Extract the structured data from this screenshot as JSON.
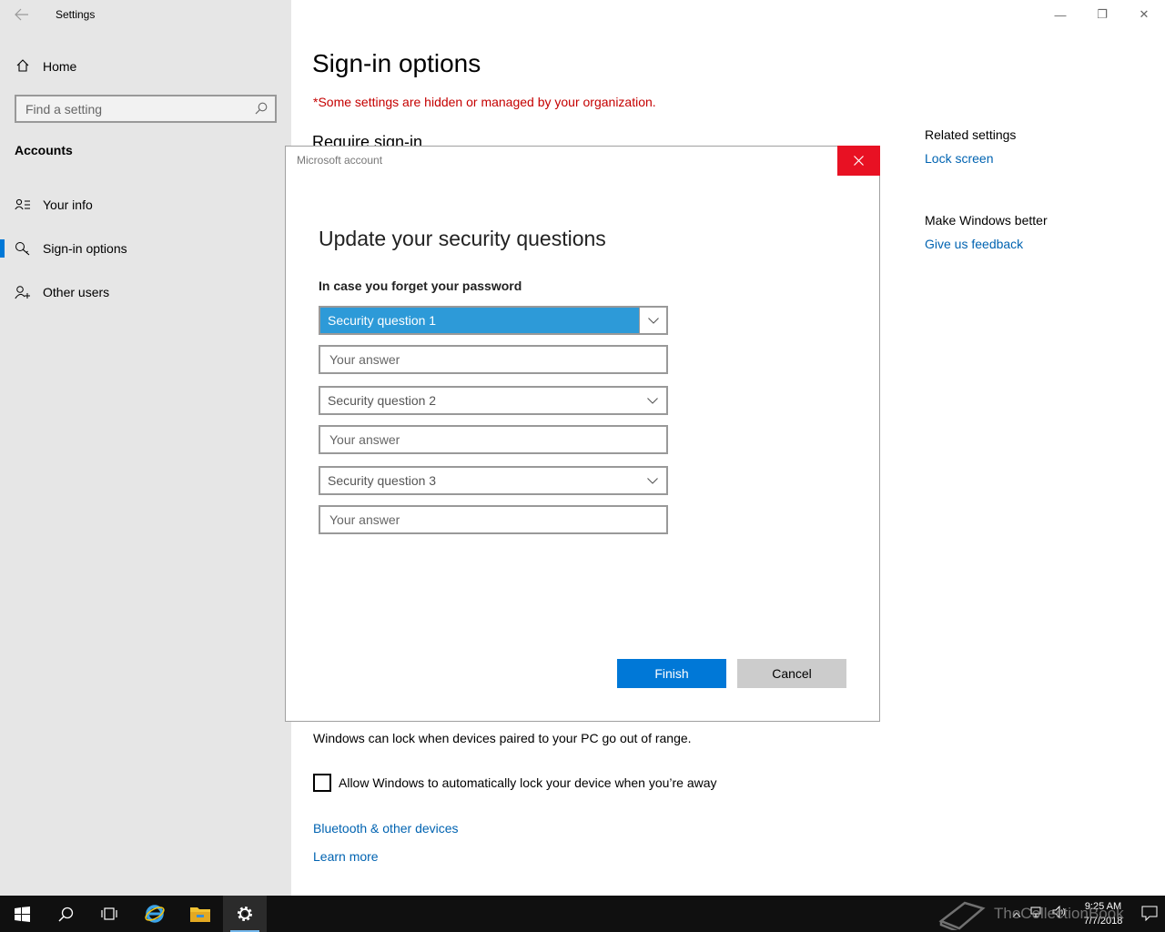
{
  "window": {
    "app_title": "Settings",
    "controls": {
      "minimize": "—",
      "restore": "❐",
      "close": "✕"
    }
  },
  "sidebar": {
    "home_label": "Home",
    "search_placeholder": "Find a setting",
    "section_title": "Accounts",
    "items": [
      {
        "label": "Your info",
        "icon": "person-card-icon",
        "active": false
      },
      {
        "label": "Sign-in options",
        "icon": "key-icon",
        "active": true
      },
      {
        "label": "Other users",
        "icon": "person-add-icon",
        "active": false
      }
    ]
  },
  "main": {
    "title": "Sign-in options",
    "org_warning": "*Some settings are hidden or managed by your organization.",
    "require_heading": "Require sign-in",
    "dynamic_lock_text": "Windows can lock when devices paired to your PC go out of range.",
    "checkbox_label": "Allow Windows to automatically lock your device when you’re away",
    "bluetooth_link": "Bluetooth & other devices",
    "learn_more_link": "Learn more"
  },
  "related": {
    "title": "Related settings",
    "lock_screen_link": "Lock screen",
    "feedback_title": "Make Windows better",
    "feedback_link": "Give us feedback"
  },
  "dialog": {
    "caption": "Microsoft account",
    "heading": "Update your security questions",
    "subheading": "In case you forget your password",
    "questions": [
      {
        "selected": "Security question 1",
        "answer_placeholder": "Your answer"
      },
      {
        "selected": "Security question 2",
        "answer_placeholder": "Your answer"
      },
      {
        "selected": "Security question 3",
        "answer_placeholder": "Your answer"
      }
    ],
    "finish_label": "Finish",
    "cancel_label": "Cancel"
  },
  "taskbar": {
    "time": "9:25 AM",
    "date": "7/7/2018",
    "watermark": "TheCollectionBook",
    "accent": "#76b9ed"
  },
  "colors": {
    "accent": "#0078d7",
    "link": "#0063b1",
    "warning": "#c50000",
    "close_red": "#e81123",
    "selected_dropdown": "#2d9ad8"
  }
}
